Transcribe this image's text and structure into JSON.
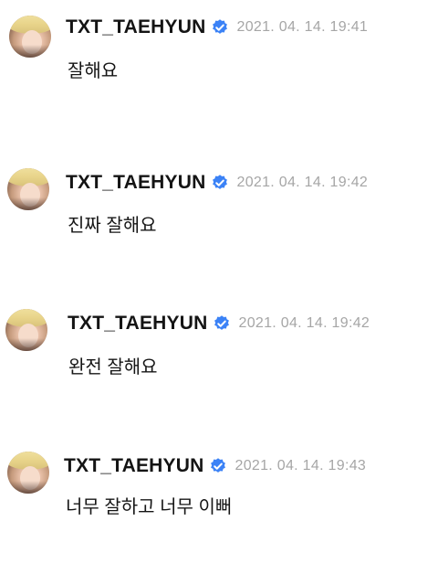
{
  "comments": [
    {
      "username": "TXT_TAEHYUN",
      "timestamp": "2021. 04. 14. 19:41",
      "text": "잘해요",
      "verified": true
    },
    {
      "username": "TXT_TAEHYUN",
      "timestamp": "2021. 04. 14. 19:42",
      "text": "진짜 잘해요",
      "verified": true
    },
    {
      "username": "TXT_TAEHYUN",
      "timestamp": "2021. 04. 14. 19:42",
      "text": "완전 잘해요",
      "verified": true
    },
    {
      "username": "TXT_TAEHYUN",
      "timestamp": "2021. 04. 14. 19:43",
      "text": "너무 잘하고 너무 이뻐",
      "verified": true
    }
  ],
  "colors": {
    "verified_badge": "#3b82f6",
    "timestamp": "#a6a6a6"
  },
  "icons": {
    "verified": "verified-badge-icon",
    "avatar": "profile-avatar"
  }
}
